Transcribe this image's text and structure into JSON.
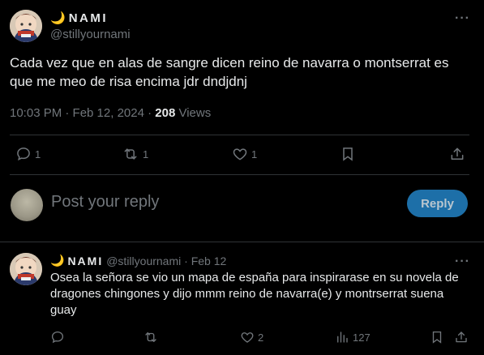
{
  "tweet": {
    "display_name": "NAMI",
    "moon": "🌙",
    "handle": "@stillyournami",
    "text": "Cada vez que en alas de sangre dicen reino de navarra o montserrat es que me meo de risa encima jdr dndjdnj",
    "time": "10:03 PM · Feb 12, 2024 · ",
    "views_count": "208",
    "views_label": " Views",
    "more": "···",
    "actions": {
      "reply_count": "1",
      "retweet_count": "1",
      "like_count": "1"
    }
  },
  "reply_box": {
    "placeholder": "Post your reply",
    "button_label": "Reply"
  },
  "reply": {
    "display_name": "NAMI",
    "moon": "🌙",
    "handle": "@stillyournami",
    "sep": " · ",
    "date": "Feb 12",
    "more": "···",
    "text": "Osea la señora se vio un mapa de españa para inspirarase en su novela de dragones chingones y dijo mmm reino de navarra(e) y montrserrat suena guay",
    "actions": {
      "like_count": "2",
      "views_count": "127"
    }
  },
  "colors": {
    "background": "#000000",
    "text": "#e7e9ea",
    "muted": "#71767b",
    "divider": "#2f3336",
    "reply_button": "#1d6fa8"
  }
}
